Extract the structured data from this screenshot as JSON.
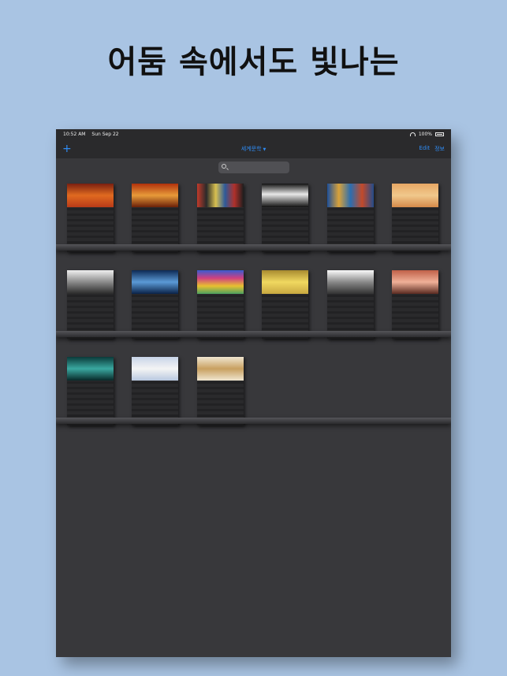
{
  "headline": "어둠 속에서도 빛나는",
  "status": {
    "time": "10:52 AM",
    "date": "Sun Sep 22",
    "battery": "100%"
  },
  "nav": {
    "add": "+",
    "title": "세계문학",
    "edit": "Edit",
    "info": "정보"
  },
  "shelves": [
    [
      {
        "title": "",
        "art": "linear-gradient(#7a1f10,#e06a20,#b83a18)"
      },
      {
        "title": "",
        "art": "linear-gradient(#b0320c,#e89a3a,#6a2008)"
      },
      {
        "title": "",
        "art": "linear-gradient(90deg,#c23a2a,#2a2a2a,#d8c050,#2e5a9a,#b0302a,#1e1e1e)"
      },
      {
        "title": "",
        "art": "linear-gradient(#111,#e8e8e8 45%,#111)"
      },
      {
        "title": "",
        "art": "linear-gradient(90deg,#1d4f9a,#d8a23a,#2b6eb0,#c34a2a,#234c8a)"
      },
      {
        "title": "",
        "art": "linear-gradient(#e7a764,#f0c88c,#d58a4a)"
      }
    ],
    [
      {
        "title": "",
        "art": "linear-gradient(#efefef,#8a8a8a,#2a2a2a)"
      },
      {
        "title": "",
        "art": "linear-gradient(#0d2a54,#5b9ad6,#0a2248)"
      },
      {
        "title": "",
        "art": "linear-gradient(#3a5bd0,#d04080,#e8c030,#4aa060)"
      },
      {
        "title": "",
        "art": "linear-gradient(#a88a30,#f0d860,#c8a840)"
      },
      {
        "title": "",
        "art": "linear-gradient(#fafafa,#888,#333)"
      },
      {
        "title": "",
        "art": "linear-gradient(#c06048,#f0b098,#5a2a20)"
      }
    ],
    [
      {
        "title": "",
        "art": "linear-gradient(#0a3a3a,#3aa8a0,#082828)"
      },
      {
        "title": "",
        "art": "linear-gradient(#c8d4e8,#f4f4f4,#b8c8e0)"
      },
      {
        "title": "",
        "art": "linear-gradient(#f0e6d0,#c8a060,#f0e6d0)"
      }
    ]
  ]
}
